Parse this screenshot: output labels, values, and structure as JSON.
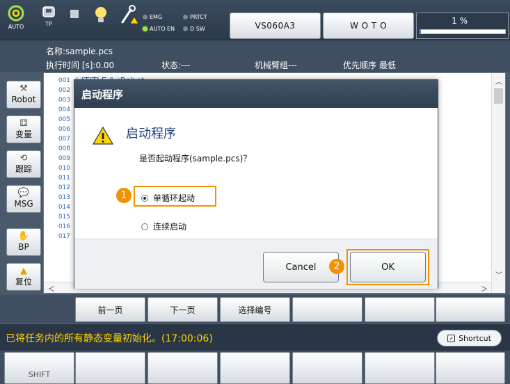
{
  "topbar": {
    "auto_label": "AUTO",
    "tp_label": "TP",
    "leds": {
      "emg": "EMG",
      "prtct": "PRTCT",
      "auto_en": "AUTO EN",
      "dsw": "D SW"
    },
    "robot_button": "VS060A3",
    "work_button": "W O T O",
    "speed_text": "1 %",
    "speed_percent": 1
  },
  "program": {
    "name": "名称:sample.pcs",
    "exec_time": "执行时间 [s]:0.00",
    "state": "状态:---",
    "arm_group": "机械臂组---",
    "priority": "优先顺序 最低"
  },
  "side_buttons": [
    {
      "label": "Robot",
      "icon": "robot-tool-icon"
    },
    {
      "label": "变量",
      "icon": "variable-icon"
    },
    {
      "label": "跟踪",
      "icon": "trace-icon"
    },
    {
      "label": "MSG",
      "icon": "message-icon"
    },
    {
      "label": "BP",
      "icon": "hand-icon"
    },
    {
      "label": "复位",
      "icon": "warning-icon"
    }
  ],
  "editor": {
    "line_numbers": [
      "001",
      "002",
      "003",
      "004",
      "005",
      "006",
      "007",
      "008",
      "009",
      "010",
      "011",
      "012",
      "013",
      "014",
      "015",
      "016",
      "017"
    ],
    "first_line_text": "' !TITLE \"<Robot..."
  },
  "dialog": {
    "title": "启动程序",
    "heading": "启动程序",
    "question": "是否起动程序(sample.pcs)？",
    "option_single": "单循环起动",
    "option_continuous": "连续启动",
    "selected_option": "single",
    "cancel_label": "Cancel",
    "ok_label": "OK",
    "callout_1": "1",
    "callout_2": "2"
  },
  "page_buttons": [
    "前一页",
    "下一页",
    "选择编号",
    "",
    "",
    ""
  ],
  "status": {
    "message": "已将任务内的所有静态变量初始化。(17:00:06)",
    "shortcut_label": "Shortcut"
  },
  "fkeys": [
    "SHIFT",
    "",
    "",
    "",
    "",
    "",
    ""
  ],
  "colors": {
    "accent_orange": "#f39200",
    "status_yellow": "#ffd400",
    "led_green": "#9ee44a"
  }
}
